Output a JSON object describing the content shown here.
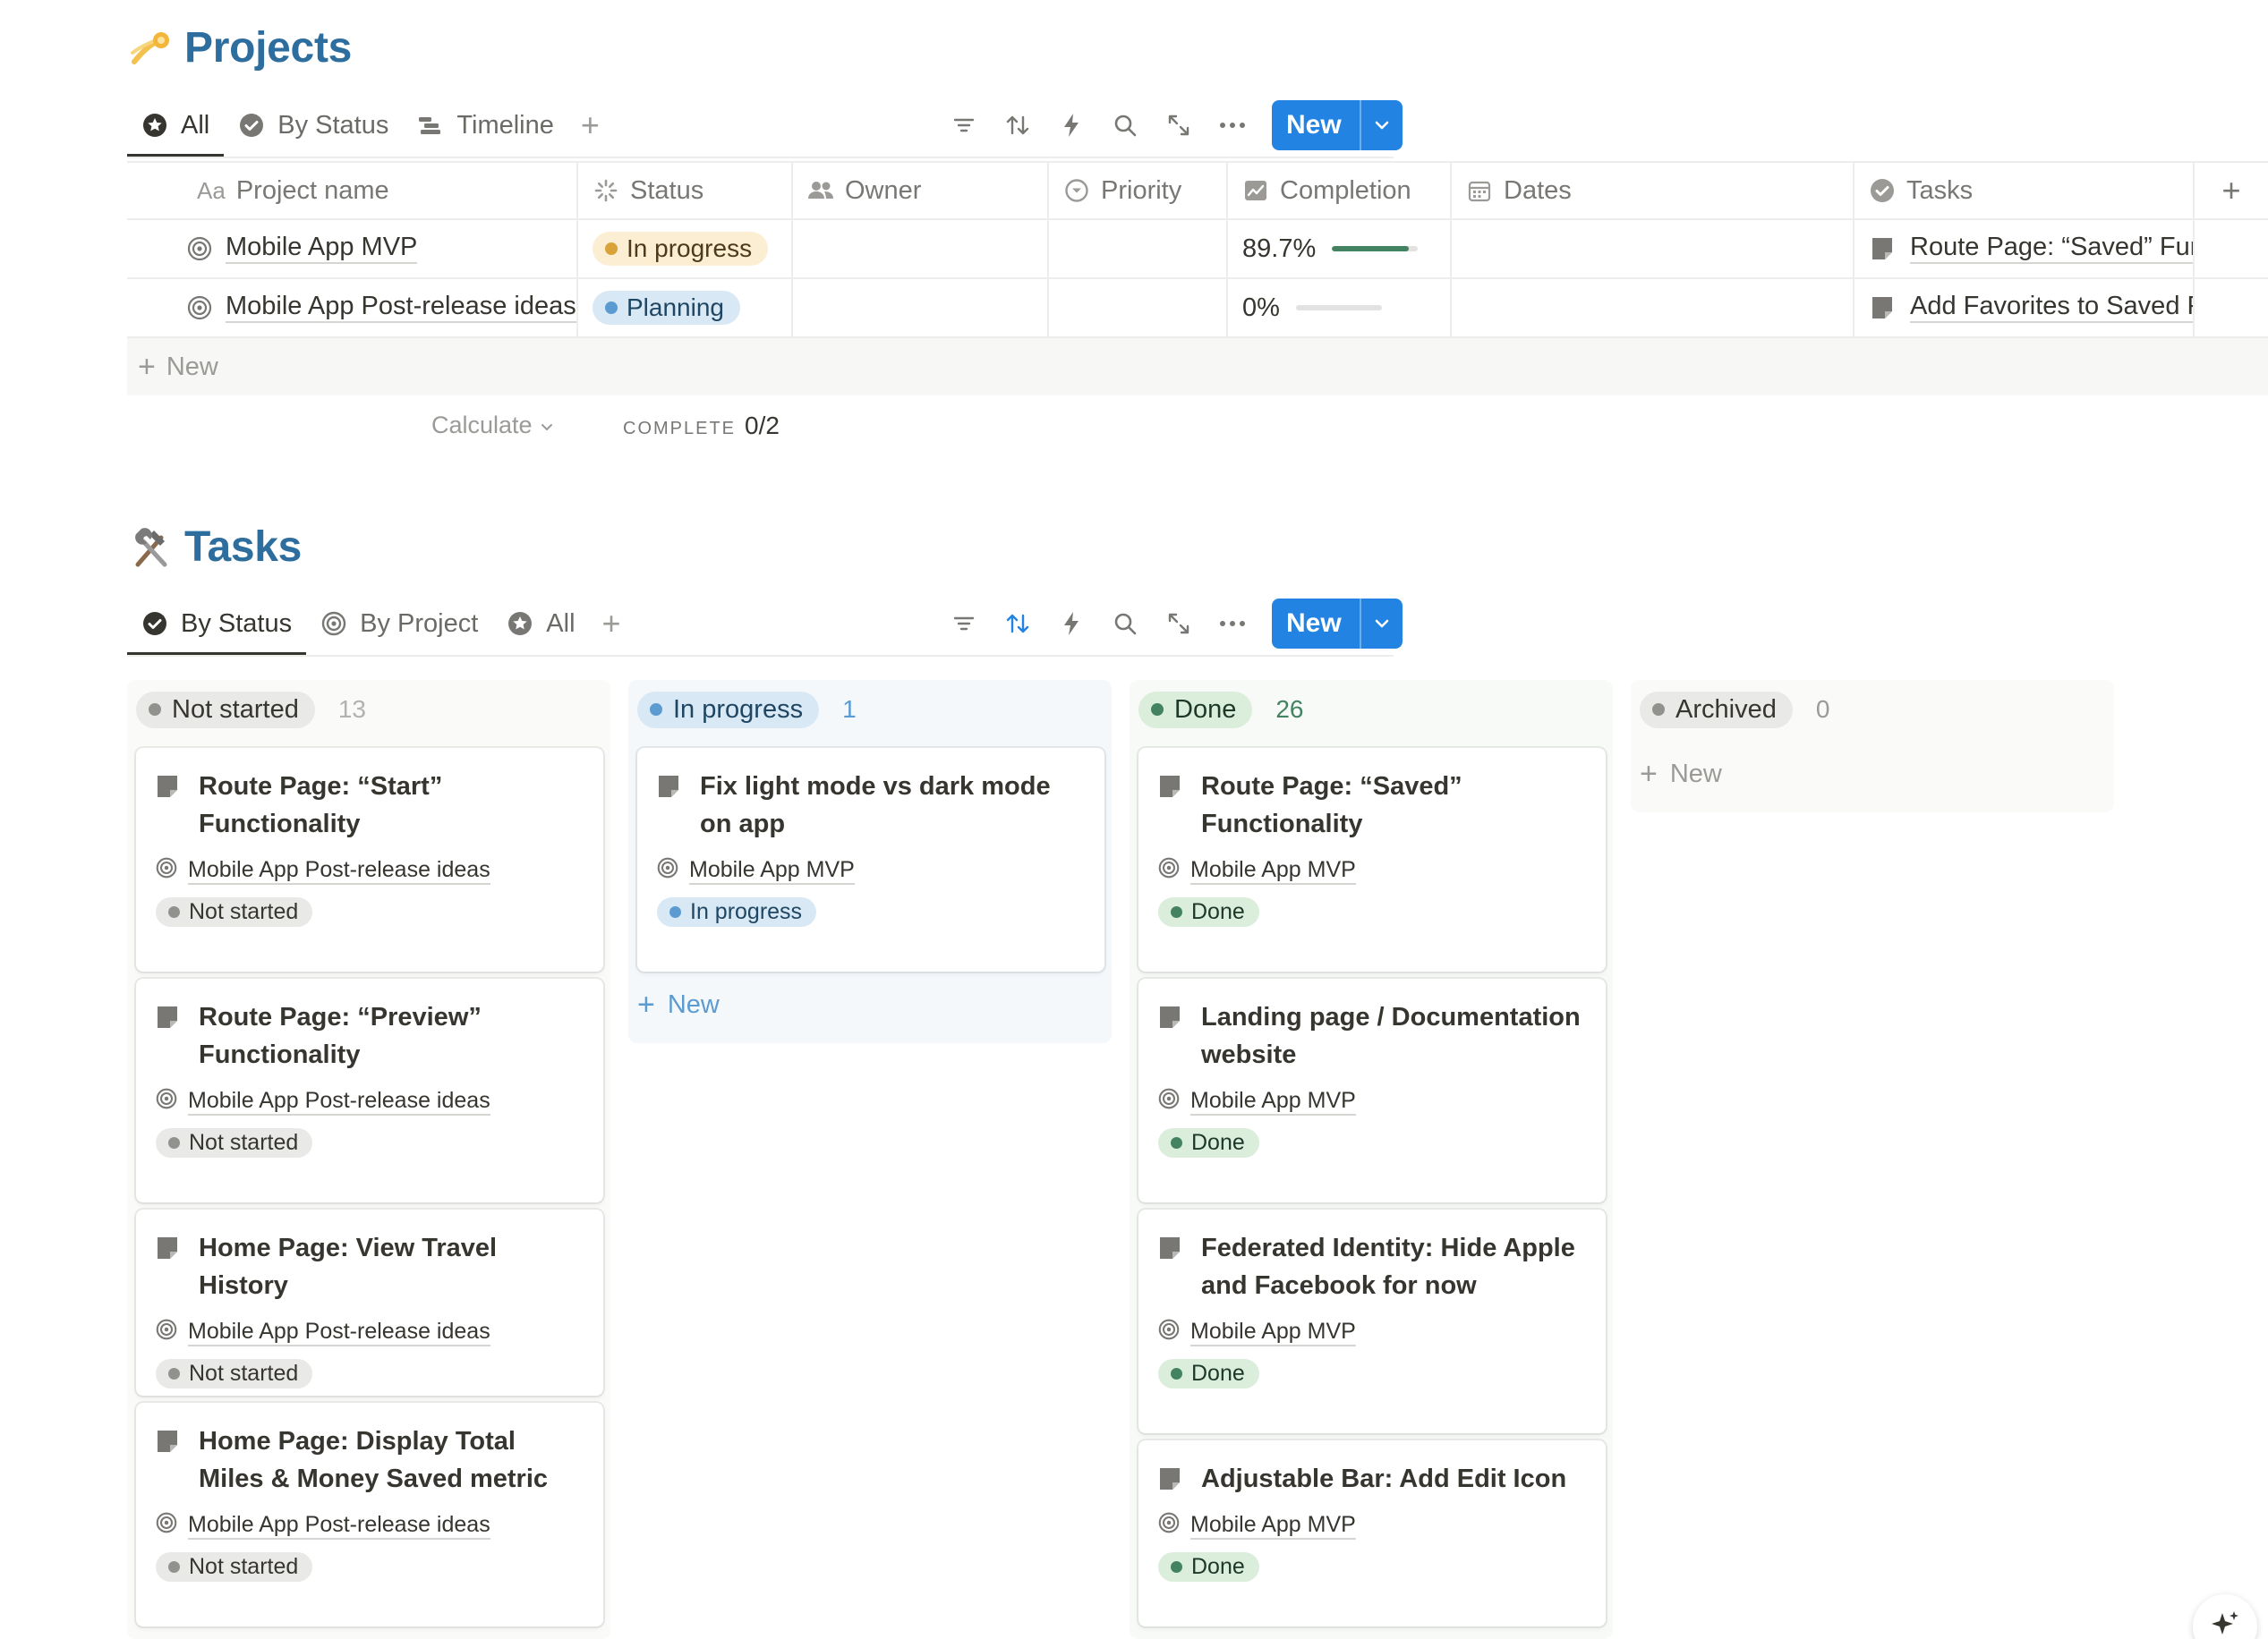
{
  "projects": {
    "title": "Projects",
    "views": [
      {
        "label": "All",
        "icon": "star-circle-icon"
      },
      {
        "label": "By Status",
        "icon": "check-circle-icon"
      },
      {
        "label": "Timeline",
        "icon": "timeline-icon"
      }
    ],
    "new_label": "New",
    "columns": {
      "name": "Project name",
      "status": "Status",
      "owner": "Owner",
      "priority": "Priority",
      "completion": "Completion",
      "dates": "Dates",
      "tasks": "Tasks"
    },
    "rows": [
      {
        "name": "Mobile App MVP",
        "status": "In progress",
        "completion": "89.7%",
        "completion_fraction": 0.897,
        "task": "Route Page: “Saved” Functionality"
      },
      {
        "name": "Mobile App Post-release ideas",
        "status": "Planning",
        "completion": "0%",
        "completion_fraction": 0,
        "task": "Add Favorites to Saved Page"
      }
    ],
    "add_row_label": "New",
    "calculate_label": "Calculate",
    "complete_label": "COMPLETE",
    "complete_value": "0/2"
  },
  "tasks": {
    "title": "Tasks",
    "views": [
      {
        "label": "By Status",
        "icon": "check-circle-icon"
      },
      {
        "label": "By Project",
        "icon": "target-icon"
      },
      {
        "label": "All",
        "icon": "star-circle-icon"
      }
    ],
    "new_label": "New",
    "groups": [
      {
        "label": "Not started",
        "count": "13",
        "cards": [
          {
            "title": "Route Page: “Start” Functionality",
            "project": "Mobile App Post-release ideas",
            "status": "Not started"
          },
          {
            "title": "Route Page: “Preview” Functionality",
            "project": "Mobile App Post-release ideas",
            "status": "Not started"
          },
          {
            "title": "Home Page: View Travel History",
            "project": "Mobile App Post-release ideas",
            "status": "Not started"
          },
          {
            "title": "Home Page: Display Total Miles & Money Saved metric",
            "project": "Mobile App Post-release ideas",
            "status": "Not started"
          }
        ]
      },
      {
        "label": "In progress",
        "count": "1",
        "cards": [
          {
            "title": "Fix light mode vs dark mode on app",
            "project": "Mobile App MVP",
            "status": "In progress"
          }
        ],
        "new_label": "New"
      },
      {
        "label": "Done",
        "count": "26",
        "cards": [
          {
            "title": "Route Page: “Saved” Functionality",
            "project": "Mobile App MVP",
            "status": "Done"
          },
          {
            "title": "Landing page / Documentation website",
            "project": "Mobile App MVP",
            "status": "Done"
          },
          {
            "title": "Federated Identity: Hide Apple and Facebook for now",
            "project": "Mobile App MVP",
            "status": "Done"
          },
          {
            "title": "Adjustable Bar: Add Edit Icon",
            "project": "Mobile App MVP",
            "status": "Done"
          }
        ]
      },
      {
        "label": "Archived",
        "count": "0",
        "cards": [],
        "new_label": "New"
      }
    ]
  },
  "colors": {
    "accent": "#2383e2",
    "heading": "#2e6e9e",
    "done": "#448361",
    "in_progress": "#5b9bd1",
    "not_started": "#91918e"
  }
}
